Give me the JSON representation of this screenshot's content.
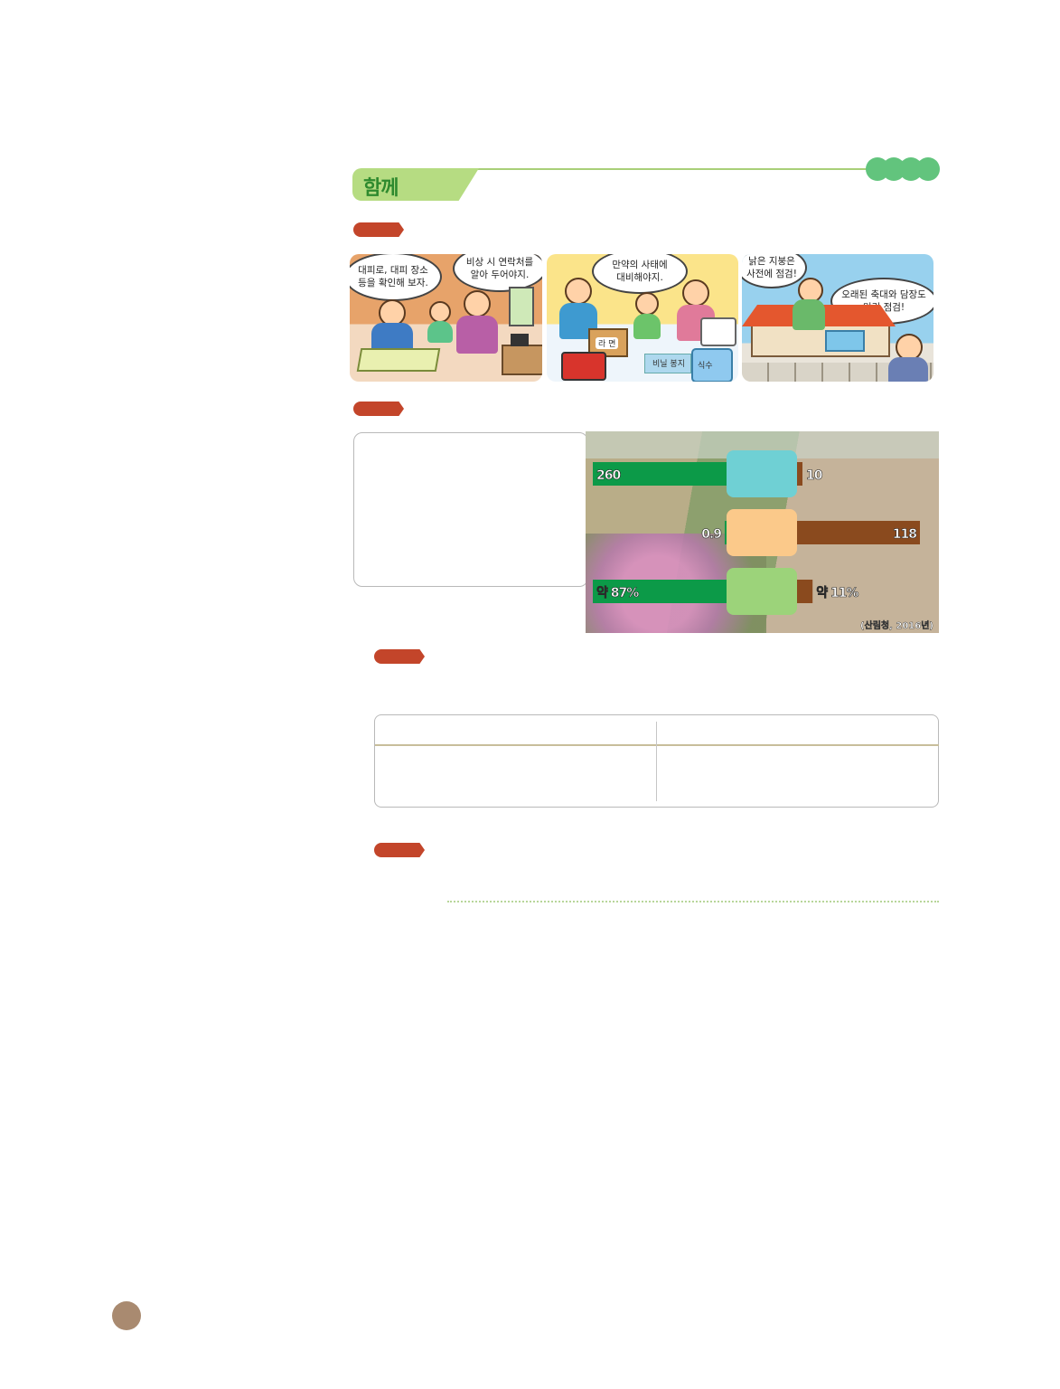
{
  "header": {
    "title": "함께",
    "accent_color": "#b6dc82",
    "dots_color": "#62c47d"
  },
  "comic": {
    "panels": [
      {
        "bubbles": [
          "대피로, 대피 장소\n등을 확인해 보자.",
          "비상 시 연락처를\n알아 두어야지."
        ]
      },
      {
        "bubbles": [
          "만약의 사태에\n대비해야지."
        ],
        "items": [
          "라 면",
          "비닐 봉지",
          "식수"
        ]
      },
      {
        "bubbles": [
          "낡은 지붕은\n사전에 점검!",
          "오래된 축대와 담장도\n미리 점검!"
        ]
      }
    ]
  },
  "chart_data": {
    "type": "bar",
    "title": "",
    "xlabel": "",
    "ylabel": "",
    "rows": [
      {
        "left_value": 260,
        "left_label": "260",
        "right_value": 10,
        "right_label": "10",
        "center_color": "#6fd0d4"
      },
      {
        "left_value": 0.9,
        "left_label": "0.9",
        "right_value": 118,
        "right_label": "118",
        "center_color": "#fbc98a"
      },
      {
        "left_value": 87,
        "left_label": "약 87%",
        "right_value": 11,
        "right_label": "약 11%",
        "center_color": "#9cd37a"
      }
    ],
    "left_series_color": "#0c9a48",
    "right_series_color": "#8a4a1e",
    "source": "(산림청, 2016년)"
  },
  "colors": {
    "label_red": "#c3452a",
    "page_circle": "#a98a70"
  }
}
